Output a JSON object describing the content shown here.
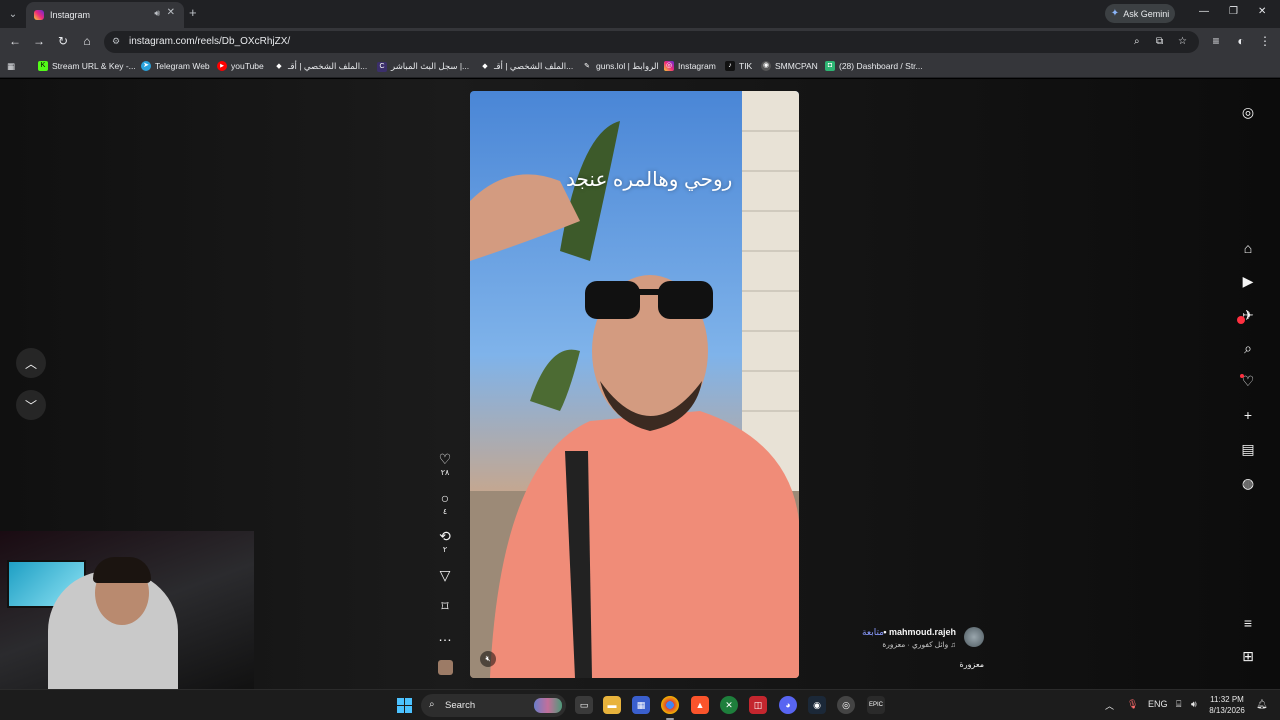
{
  "browser": {
    "tab": {
      "title": "Instagram"
    },
    "gemini_label": "Ask Gemini",
    "url": "instagram.com/reels/Db_OXcRhjZX/",
    "bookmarks": [
      {
        "label": "Stream URL & Key -...",
        "color": "#53fc18",
        "glyph": "K"
      },
      {
        "label": "Telegram Web",
        "color": "#2aa3dd",
        "glyph": "➤"
      },
      {
        "label": "youTube",
        "color": "#ff0000",
        "glyph": "▶"
      },
      {
        "label": "الملف الشخصي | أقـ...",
        "color": "#444444",
        "glyph": "◆"
      },
      {
        "label": "سجل البث المباشر |...",
        "color": "#3b2f6b",
        "glyph": "C"
      },
      {
        "label": "الملف الشخصي | أقـ...",
        "color": "#444444",
        "glyph": "◆"
      },
      {
        "label": "guns.lol | الروابط",
        "color": "#333333",
        "glyph": "✎"
      },
      {
        "label": "Instagram",
        "color": "#e1306c",
        "glyph": "◎"
      },
      {
        "label": "TIK",
        "color": "#111111",
        "glyph": "♪"
      },
      {
        "label": "SMMCPAN",
        "color": "#555555",
        "glyph": "◉"
      },
      {
        "label": "(28) Dashboard / Str...",
        "color": "#2db573",
        "glyph": "◘"
      }
    ]
  },
  "reel": {
    "overlay_text": "روحي وهالمره عنجد",
    "actions": {
      "likes": "٢٨",
      "comments": "٤",
      "reposts": "٢"
    },
    "author": {
      "username": "mahmoud.rajeh",
      "follow_label": "متابعة",
      "separator": "•",
      "audio": "وائل كفوري · معزورة",
      "caption": "معزورة"
    }
  },
  "taskbar": {
    "search_label": "Search",
    "lang": "ENG",
    "time": "11:32 PM",
    "date": "8/13/2026"
  },
  "colors": {
    "accent_follow": "#8a9bff",
    "notification": "#ff3040",
    "windows_accent": "#4cc2ff"
  }
}
